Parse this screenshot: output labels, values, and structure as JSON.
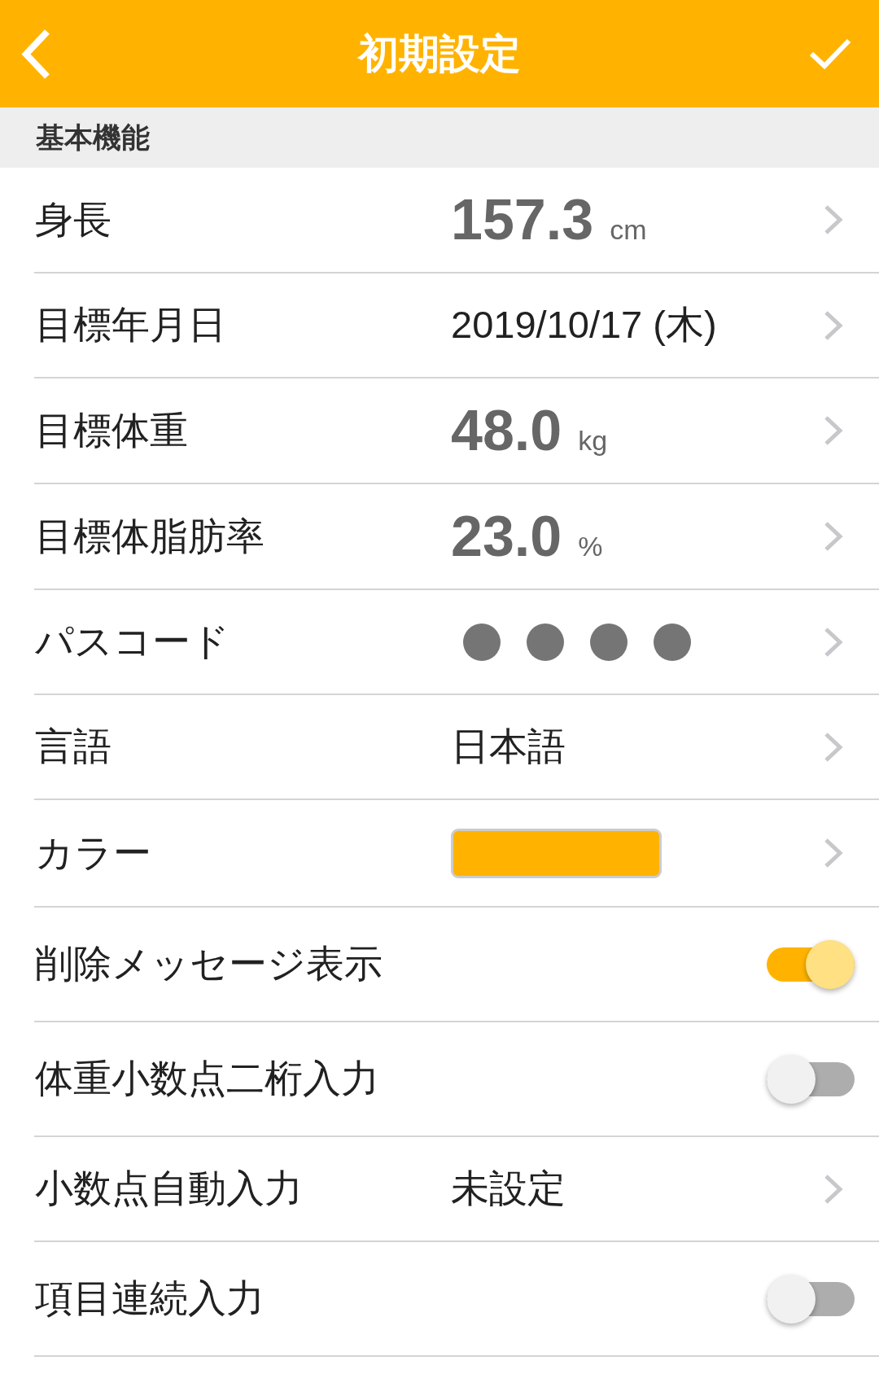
{
  "header": {
    "title": "初期設定"
  },
  "section": {
    "title": "基本機能"
  },
  "rows": [
    {
      "kind": "measure",
      "label": "身長",
      "value": "157.3",
      "unit": "cm"
    },
    {
      "kind": "text",
      "label": "目標年月日",
      "value": "2019/10/17 (木)"
    },
    {
      "kind": "measure",
      "label": "目標体重",
      "value": "48.0",
      "unit": "kg"
    },
    {
      "kind": "measure",
      "label": "目標体脂肪率",
      "value": "23.0",
      "unit": "%"
    },
    {
      "kind": "passcode",
      "label": "パスコード",
      "dots": [
        {
          "filled": true
        },
        {
          "filled": true
        },
        {
          "filled": true
        },
        {
          "filled": true
        }
      ]
    },
    {
      "kind": "text",
      "label": "言語",
      "value": "日本語"
    },
    {
      "kind": "color",
      "label": "カラー",
      "color": "#ffb300"
    },
    {
      "kind": "toggle",
      "label": "削除メッセージ表示",
      "on": true
    },
    {
      "kind": "toggle",
      "label": "体重小数点二桁入力",
      "on": false
    },
    {
      "kind": "text",
      "label": "小数点自動入力",
      "value": "未設定"
    },
    {
      "kind": "toggle",
      "label": "項目連続入力",
      "on": false
    }
  ]
}
